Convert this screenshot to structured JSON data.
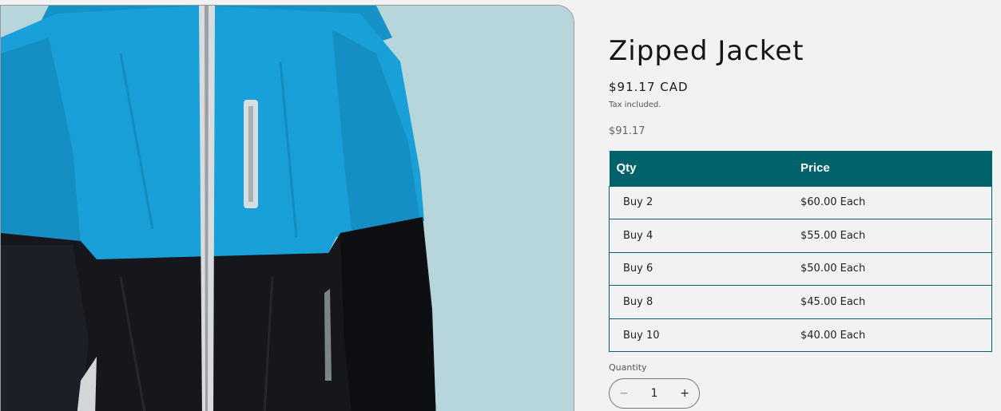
{
  "product": {
    "title": "Zipped Jacket",
    "price": "$91.17 CAD",
    "tax_note": "Tax included.",
    "unit_price": "$91.17"
  },
  "tier_table": {
    "headers": [
      "Qty",
      "Price"
    ],
    "rows": [
      {
        "qty": "Buy 2",
        "price": "$60.00 Each"
      },
      {
        "qty": "Buy 4",
        "price": "$55.00 Each"
      },
      {
        "qty": "Buy 6",
        "price": "$50.00 Each"
      },
      {
        "qty": "Buy 8",
        "price": "$45.00 Each"
      },
      {
        "qty": "Buy 10",
        "price": "$40.00 Each"
      }
    ]
  },
  "quantity": {
    "label": "Quantity",
    "value": "1",
    "decrement": "−",
    "increment": "+"
  },
  "colors": {
    "accent": "#00636b",
    "background": "#f2f2f2",
    "photo_background": "#b7d6dc",
    "jacket_blue": "#1aa0d8",
    "jacket_black": "#15171c"
  }
}
